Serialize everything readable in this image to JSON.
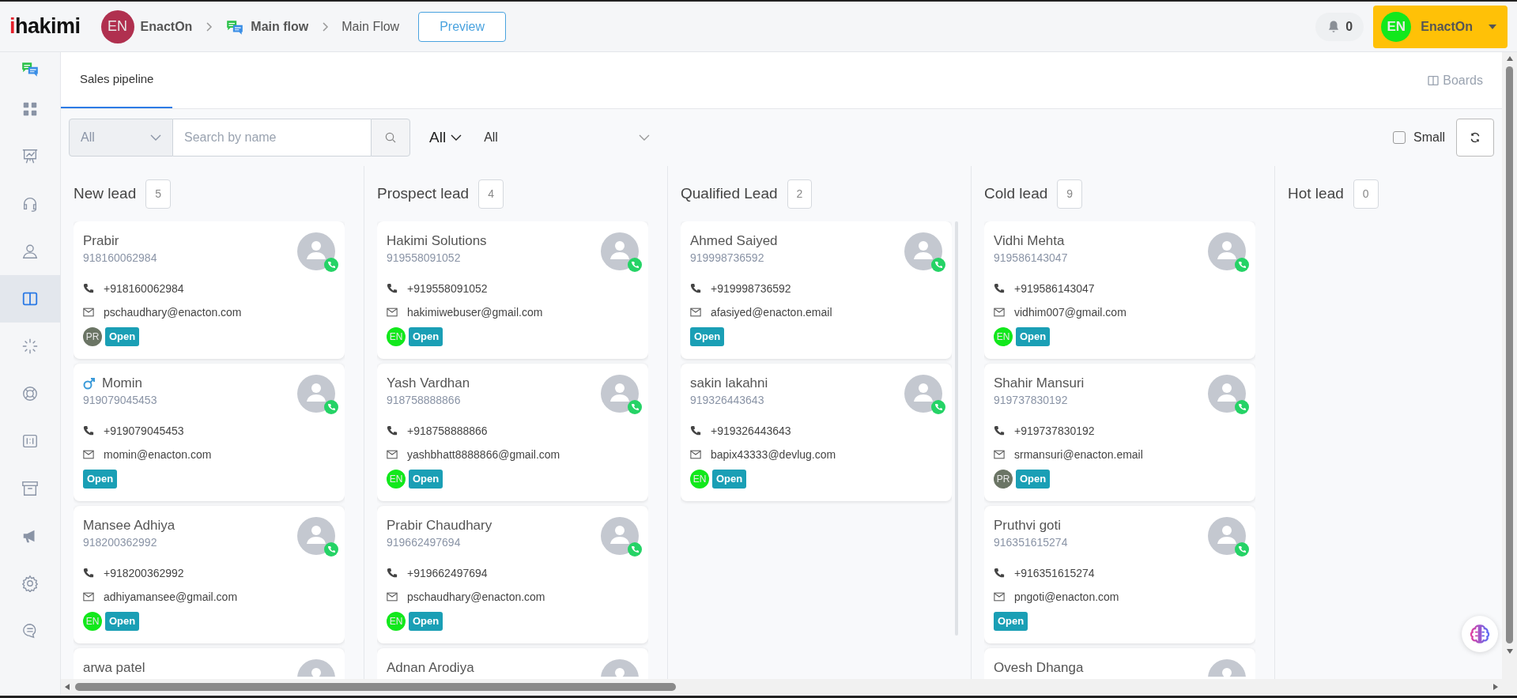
{
  "header": {
    "logo": "ihakimi",
    "org": {
      "initials": "EN",
      "color": "#b0304f",
      "name": "EnactOn"
    },
    "breadcrumbs": [
      {
        "label": "Main flow",
        "bold": true
      },
      {
        "label": "Main Flow",
        "bold": false
      }
    ],
    "preview_button": "Preview",
    "notifications": {
      "count": "0"
    },
    "user": {
      "initials": "EN",
      "color": "#12e81c",
      "name": "EnactOn"
    }
  },
  "sidebar": {
    "items": [
      {
        "selected": false
      },
      {
        "selected": false
      },
      {
        "selected": false
      },
      {
        "selected": false
      },
      {
        "selected": false
      },
      {
        "selected": true
      },
      {
        "selected": false
      },
      {
        "selected": false
      },
      {
        "selected": false
      },
      {
        "selected": false
      },
      {
        "selected": false
      },
      {
        "selected": false
      },
      {
        "selected": false
      }
    ]
  },
  "tabs": [
    {
      "label": "Sales pipeline",
      "selected": true
    }
  ],
  "boards_link": "Boards",
  "filters": {
    "type_select": "All",
    "search": {
      "placeholder": "Search by name"
    },
    "owner_dropdown": "All",
    "status_select": "All",
    "small": {
      "label": "Small",
      "checked": false
    }
  },
  "columns": [
    {
      "title": "New lead",
      "count": "5",
      "cards": [
        {
          "name": "Prabir",
          "number": "918160062984",
          "phone": "+918160062984",
          "email": "pschaudhary@enacton.com",
          "assignee": {
            "initials": "PR",
            "color": "#6b7565"
          },
          "status": "Open"
        },
        {
          "name": "Momin",
          "male": true,
          "number": "919079045453",
          "phone": "+919079045453",
          "email": "momin@enacton.com",
          "status": "Open"
        },
        {
          "name": "Mansee Adhiya",
          "number": "918200362992",
          "phone": "+918200362992",
          "email": "adhiyamansee@gmail.com",
          "assignee": {
            "initials": "EN",
            "color": "#12e81c"
          },
          "status": "Open"
        },
        {
          "name": "arwa patel"
        }
      ]
    },
    {
      "title": "Prospect lead",
      "count": "4",
      "cards": [
        {
          "name": "Hakimi Solutions",
          "number": "919558091052",
          "phone": "+919558091052",
          "email": "hakimiwebuser@gmail.com",
          "assignee": {
            "initials": "EN",
            "color": "#12e81c"
          },
          "status": "Open"
        },
        {
          "name": "Yash Vardhan",
          "number": "918758888866",
          "phone": "+918758888866",
          "email": "yashbhatt8888866@gmail.com",
          "assignee": {
            "initials": "EN",
            "color": "#12e81c"
          },
          "status": "Open"
        },
        {
          "name": "Prabir Chaudhary",
          "number": "919662497694",
          "phone": "+919662497694",
          "email": "pschaudhary@enacton.com",
          "assignee": {
            "initials": "EN",
            "color": "#12e81c"
          },
          "status": "Open"
        },
        {
          "name": "Adnan Arodiya"
        }
      ]
    },
    {
      "title": "Qualified Lead",
      "count": "2",
      "cards": [
        {
          "name": "Ahmed Saiyed",
          "number": "919998736592",
          "phone": "+919998736592",
          "email": "afasiyed@enacton.email",
          "status": "Open"
        },
        {
          "name": "sakin lakahni",
          "number": "919326443643",
          "phone": "+919326443643",
          "email": "bapix43333@devlug.com",
          "assignee": {
            "initials": "EN",
            "color": "#12e81c"
          },
          "status": "Open"
        }
      ]
    },
    {
      "title": "Cold lead",
      "count": "9",
      "cards": [
        {
          "name": "Vidhi Mehta",
          "number": "919586143047",
          "phone": "+919586143047",
          "email": "vidhim007@gmail.com",
          "assignee": {
            "initials": "EN",
            "color": "#12e81c"
          },
          "status": "Open"
        },
        {
          "name": "Shahir Mansuri",
          "number": "919737830192",
          "phone": "+919737830192",
          "email": "srmansuri@enacton.email",
          "assignee": {
            "initials": "PR",
            "color": "#6b7565"
          },
          "status": "Open"
        },
        {
          "name": "Pruthvi goti",
          "number": "916351615274",
          "phone": "+916351615274",
          "email": "pngoti@enacton.com",
          "status": "Open"
        },
        {
          "name": "Ovesh Dhanga"
        }
      ]
    },
    {
      "title": "Hot lead",
      "count": "0"
    }
  ]
}
